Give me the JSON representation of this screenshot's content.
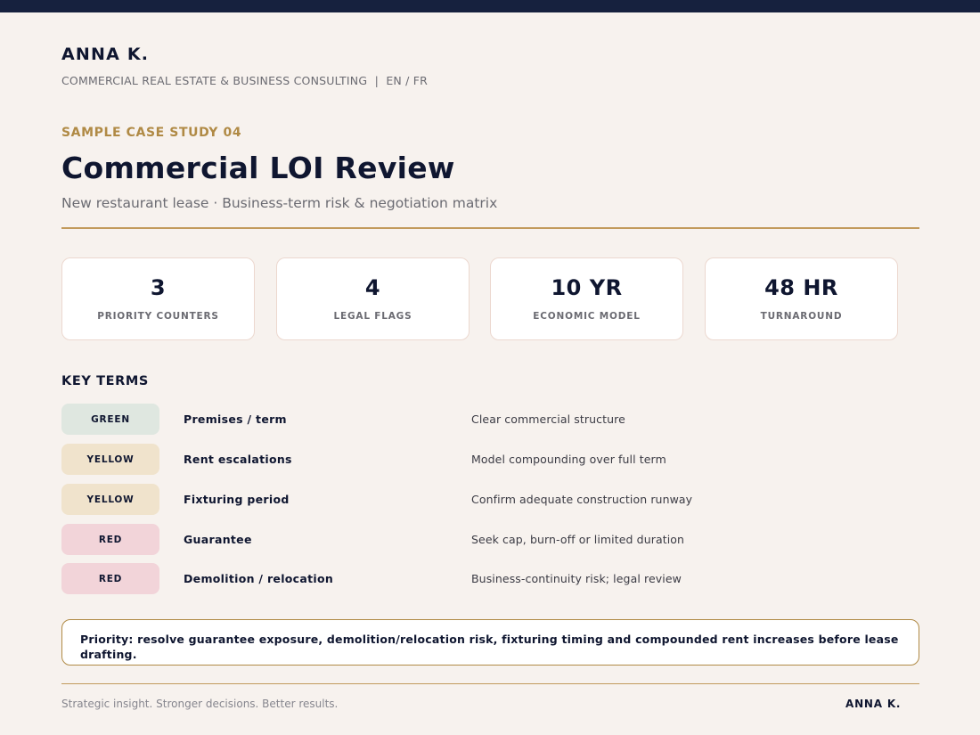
{
  "header": {
    "brand": "ANNA K.",
    "tagline": "COMMERCIAL REAL ESTATE & BUSINESS CONSULTING  |  EN / FR"
  },
  "case": {
    "eyebrow": "SAMPLE CASE STUDY 04",
    "title": "Commercial LOI Review",
    "subtitle": "New restaurant lease · Business-term risk & negotiation matrix"
  },
  "stats": [
    {
      "value": "3",
      "label": "PRIORITY COUNTERS"
    },
    {
      "value": "4",
      "label": "LEGAL FLAGS"
    },
    {
      "value": "10 YR",
      "label": "ECONOMIC MODEL"
    },
    {
      "value": "48 HR",
      "label": "TURNAROUND"
    }
  ],
  "key_terms": {
    "heading": "KEY TERMS",
    "rows": [
      {
        "status": "GREEN",
        "term": "Premises / term",
        "note": "Clear commercial structure"
      },
      {
        "status": "YELLOW",
        "term": "Rent escalations",
        "note": "Model compounding over full term"
      },
      {
        "status": "YELLOW",
        "term": "Fixturing period",
        "note": "Confirm adequate construction runway"
      },
      {
        "status": "RED",
        "term": "Guarantee",
        "note": "Seek cap, burn-off or limited duration"
      },
      {
        "status": "RED",
        "term": "Demolition / relocation",
        "note": "Business-continuity risk; legal review"
      }
    ]
  },
  "priority": "Priority: resolve guarantee exposure, demolition/relocation risk, fixturing timing and compounded rent increases before lease drafting.",
  "footer": {
    "tagline": "Strategic insight. Stronger decisions. Better results.",
    "brand": "ANNA K."
  },
  "colors": {
    "navy": "#16213e",
    "gold": "#b08a45",
    "green_badge": "#dfe7e0",
    "yellow_badge": "#f0e3cc",
    "red_badge": "#f2d4d9",
    "page_background": "#f7f2ee"
  }
}
